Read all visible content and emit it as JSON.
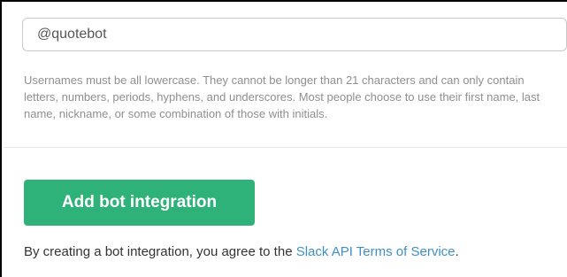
{
  "form": {
    "username_value": "@quotebot",
    "username_help": "Usernames must be all lowercase. They cannot be longer than 21 characters and can only contain letters, numbers, periods, hyphens, and underscores. Most people choose to use their first name, last name, nickname, or some combination of those with initials.",
    "submit_label": "Add bot integration",
    "terms_prefix": "By creating a bot integration, you agree to the ",
    "terms_link": "Slack API Terms of Service",
    "terms_suffix": "."
  },
  "colors": {
    "button_green": "#2fb27a",
    "link_blue": "#3f8fc4",
    "help_gray": "#8f8f8f"
  }
}
